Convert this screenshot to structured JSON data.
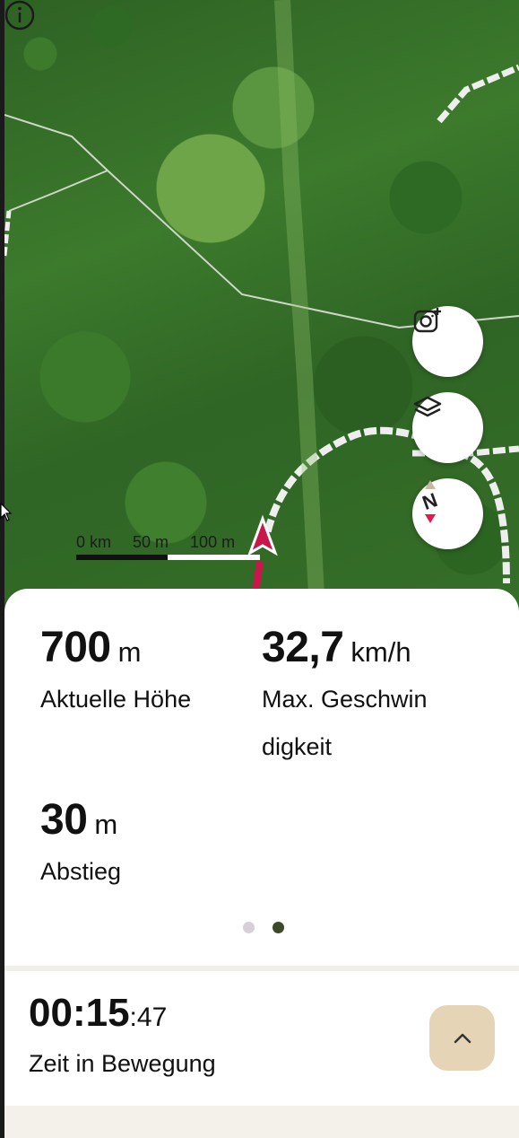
{
  "map": {
    "scale_labels": [
      "0 km",
      "50 m",
      "100 m"
    ]
  },
  "buttons": {
    "camera_icon": "camera-plus-icon",
    "layers_icon": "layers-icon",
    "compass_icon": "compass-north-icon",
    "compass_letter": "N"
  },
  "stats": [
    {
      "value": "700",
      "unit": "m",
      "label": "Aktuelle Höhe"
    },
    {
      "value": "32,7",
      "unit": "km/h",
      "label_line1": "Max. Geschwin",
      "label_line2": "digkeit"
    },
    {
      "value": "30",
      "unit": "m",
      "label": "Abstieg"
    }
  ],
  "pager": {
    "pages": 2,
    "active": 2
  },
  "timer": {
    "hhmm": "00:15",
    "seconds": ":47",
    "label": "Zeit in Bewegung"
  },
  "colors": {
    "accent_tan": "#e5d4b5",
    "route_red": "#c8174a",
    "dot_active": "#3c4a26",
    "dot_inactive": "#d8d0d6"
  }
}
